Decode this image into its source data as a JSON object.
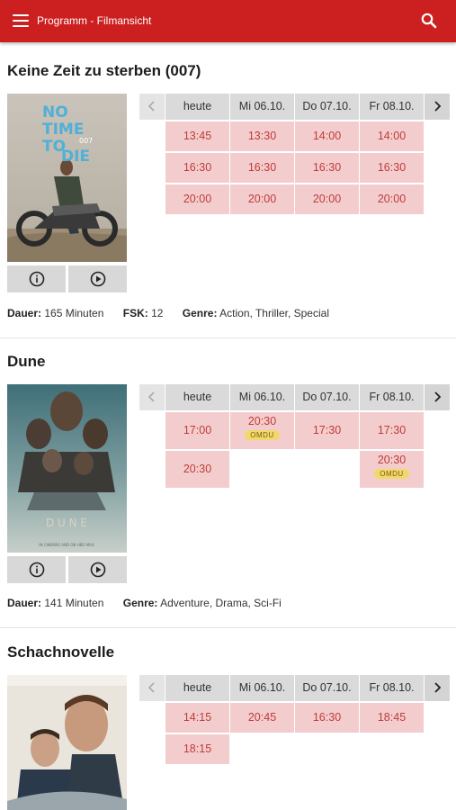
{
  "appbar": {
    "title": "Programm - Filmansicht",
    "menu_icon": "menu-icon",
    "search_icon": "search-icon",
    "color": "#cc1f1f"
  },
  "days": [
    "heute",
    "Mi 06.10.",
    "Do 07.10.",
    "Fr 08.10."
  ],
  "labels": {
    "duration": "Dauer:",
    "fsk": "FSK:",
    "genre": "Genre:"
  },
  "movies": [
    {
      "title": "Keine Zeit zu sterben (007)",
      "poster_text": [
        "NO",
        "TIME",
        "TO",
        "DIE",
        "007"
      ],
      "rows": [
        [
          "13:45",
          "13:30",
          "14:00",
          "14:00"
        ],
        [
          "16:30",
          "16:30",
          "16:30",
          "16:30"
        ],
        [
          "20:00",
          "20:00",
          "20:00",
          "20:00"
        ]
      ],
      "duration": "165 Minuten",
      "fsk": "12",
      "genre": "Action, Thriller, Special"
    },
    {
      "title": "Dune",
      "poster_text": [
        "D U N E",
        "IN CINEMAS AND ON HBO MAX"
      ],
      "rows": [
        [
          {
            "time": "17:00"
          },
          {
            "time": "20:30",
            "badge": "OMDU"
          },
          {
            "time": "17:30"
          },
          {
            "time": "17:30"
          }
        ],
        [
          {
            "time": "20:30"
          },
          null,
          null,
          {
            "time": "20:30",
            "badge": "OMDU"
          }
        ]
      ],
      "duration": "141 Minuten",
      "genre": "Adventure, Drama, Sci-Fi"
    },
    {
      "title": "Schachnovelle",
      "rows": [
        [
          "14:15",
          "20:45",
          "16:30",
          "18:45"
        ],
        [
          "18:15",
          null,
          null,
          null
        ]
      ]
    }
  ]
}
